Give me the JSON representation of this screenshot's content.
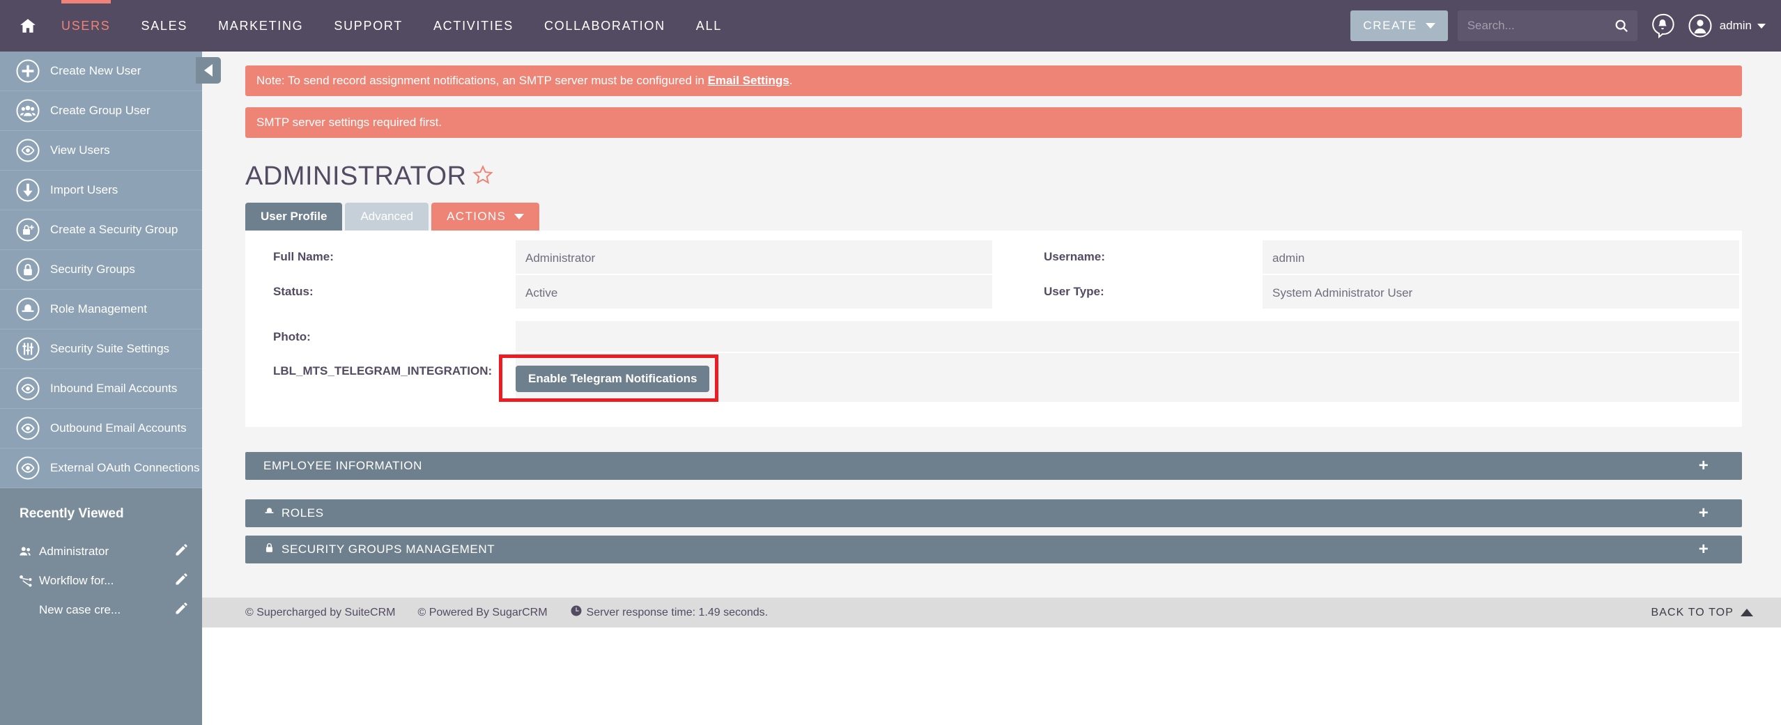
{
  "navbar": {
    "home_icon": "home-icon",
    "items": [
      {
        "label": "USERS",
        "active": true
      },
      {
        "label": "SALES",
        "active": false
      },
      {
        "label": "MARKETING",
        "active": false
      },
      {
        "label": "SUPPORT",
        "active": false
      },
      {
        "label": "ACTIVITIES",
        "active": false
      },
      {
        "label": "COLLABORATION",
        "active": false
      },
      {
        "label": "ALL",
        "active": false
      }
    ],
    "create_label": "CREATE",
    "search_placeholder": "Search...",
    "search_value": "",
    "notification_icon": "bell-notification-icon",
    "profile_icon": "user-avatar-icon",
    "admin_label": "admin",
    "accent_color": "#f08377",
    "bar_color": "#534b62"
  },
  "sidebar": {
    "items": [
      {
        "label": "Create New User",
        "icon": "plus-circle-icon"
      },
      {
        "label": "Create Group User",
        "icon": "group-users-circle-icon"
      },
      {
        "label": "View Users",
        "icon": "eye-circle-icon"
      },
      {
        "label": "Import Users",
        "icon": "down-arrow-circle-icon"
      },
      {
        "label": "Create a Security Group",
        "icon": "lock-plus-circle-icon"
      },
      {
        "label": "Security Groups",
        "icon": "lock-circle-icon"
      },
      {
        "label": "Role Management",
        "icon": "role-hat-circle-icon"
      },
      {
        "label": "Security Suite Settings",
        "icon": "sliders-circle-icon"
      },
      {
        "label": "Inbound Email Accounts",
        "icon": "eye-circle-icon"
      },
      {
        "label": "Outbound Email Accounts",
        "icon": "eye-circle-icon"
      },
      {
        "label": "External OAuth Connections",
        "icon": "eye-circle-icon"
      }
    ],
    "recently_viewed_title": "Recently Viewed",
    "recently_viewed": [
      {
        "label": "Administrator",
        "icon": "users-icon",
        "edit_icon": "pencil-icon"
      },
      {
        "label": "Workflow for...",
        "icon": "workflow-icon",
        "edit_icon": "pencil-icon"
      },
      {
        "label": "New case cre...",
        "icon": "",
        "edit_icon": "pencil-icon"
      }
    ],
    "collapse_icon": "chevron-left-icon",
    "bg_color": "#8da2b4"
  },
  "alerts": [
    {
      "pre": "Note: To send record assignment notifications, an SMTP server must be configured in ",
      "link": "Email Settings",
      "post": ".",
      "color": "#ee8476"
    },
    {
      "pre": "SMTP server settings required first.",
      "link": "",
      "post": "",
      "color": "#ee8476"
    }
  ],
  "record": {
    "title": "ADMINISTRATOR",
    "favorite_icon": "star-outline-icon",
    "tabs": [
      {
        "label": "User Profile",
        "state": "selected"
      },
      {
        "label": "Advanced",
        "state": "unselected"
      },
      {
        "label": "ACTIONS",
        "state": "actions"
      }
    ],
    "fields": {
      "full_name_label": "Full Name:",
      "full_name_value": "Administrator",
      "username_label": "Username:",
      "username_value": "admin",
      "status_label": "Status:",
      "status_value": "Active",
      "user_type_label": "User Type:",
      "user_type_value": "System Administrator User",
      "photo_label": "Photo:",
      "photo_value": "",
      "telegram_label": "LBL_MTS_TELEGRAM_INTEGRATION:",
      "telegram_button": "Enable Telegram Notifications"
    },
    "highlight_color": "#ee1b22"
  },
  "collapsed_panels": [
    {
      "label": "EMPLOYEE INFORMATION",
      "icon": "",
      "expand": "+"
    },
    {
      "label": "ROLES",
      "icon": "role-hat-icon",
      "expand": "+"
    },
    {
      "label": "SECURITY GROUPS MANAGEMENT",
      "icon": "lock-icon",
      "expand": "+"
    }
  ],
  "footer": {
    "supercharged": "© Supercharged by SuiteCRM",
    "powered": "© Powered By SugarCRM",
    "response_icon": "clock-icon",
    "response": "Server response time: 1.49 seconds.",
    "back_to_top": "BACK TO TOP"
  }
}
